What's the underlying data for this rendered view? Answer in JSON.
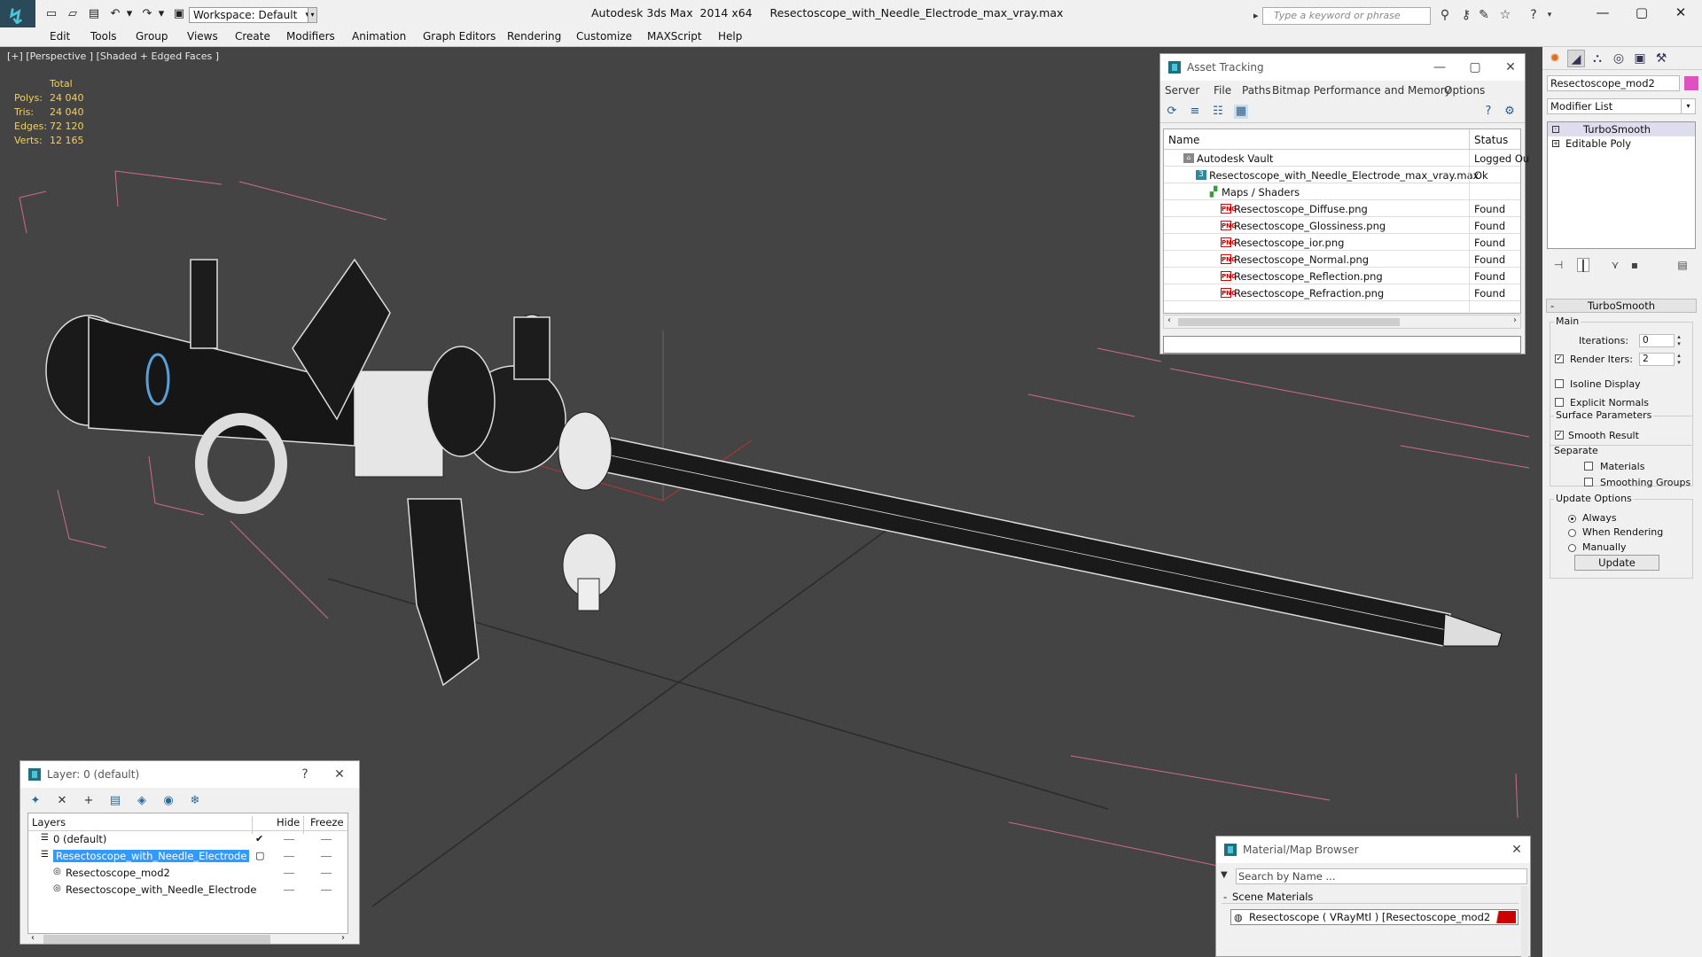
{
  "title": {
    "app": "Autodesk 3ds Max  2014 x64",
    "file": "Resectoscope_with_Needle_Electrode_max_vray.max",
    "workspace": "Workspace: Default",
    "search_placeholder": "Type a keyword or phrase"
  },
  "menu": [
    "Edit",
    "Tools",
    "Group",
    "Views",
    "Create",
    "Modifiers",
    "Animation",
    "Graph Editors",
    "Rendering",
    "Customize",
    "MAXScript",
    "Help"
  ],
  "viewport": {
    "label": "[+] [Perspective ] [Shaded + Edged Faces ]",
    "stats": {
      "header": "Total",
      "rows": [
        {
          "key": "Polys:",
          "value": "24 040"
        },
        {
          "key": "Tris:",
          "value": "24 040"
        },
        {
          "key": "Edges:",
          "value": "72 120"
        },
        {
          "key": "Verts:",
          "value": "12 165"
        }
      ]
    }
  },
  "asset_tracking": {
    "title": "Asset Tracking",
    "menu": [
      "Server",
      "File",
      "Paths",
      "Bitmap Performance and Memory",
      "Options"
    ],
    "columns": {
      "name": "Name",
      "status": "Status"
    },
    "rows": [
      {
        "name": "Autodesk Vault",
        "status": "Logged Ou",
        "indent": 0,
        "icon": "vault"
      },
      {
        "name": "Resectoscope_with_Needle_Electrode_max_vray.max",
        "status": "Ok",
        "indent": 1,
        "icon": "max"
      },
      {
        "name": "Maps / Shaders",
        "status": "",
        "indent": 2,
        "icon": "maps"
      },
      {
        "name": "Resectoscope_Diffuse.png",
        "status": "Found",
        "indent": 3,
        "icon": "png"
      },
      {
        "name": "Resectoscope_Glossiness.png",
        "status": "Found",
        "indent": 3,
        "icon": "png"
      },
      {
        "name": "Resectoscope_ior.png",
        "status": "Found",
        "indent": 3,
        "icon": "png"
      },
      {
        "name": "Resectoscope_Normal.png",
        "status": "Found",
        "indent": 3,
        "icon": "png"
      },
      {
        "name": "Resectoscope_Reflection.png",
        "status": "Found",
        "indent": 3,
        "icon": "png"
      },
      {
        "name": "Resectoscope_Refraction.png",
        "status": "Found",
        "indent": 3,
        "icon": "png"
      }
    ]
  },
  "layers": {
    "title": "Layer: 0 (default)",
    "help": "?",
    "columns": {
      "layers": "Layers",
      "hide": "Hide",
      "freeze": "Freeze"
    },
    "rows": [
      {
        "name": "0 (default)",
        "indent": 0,
        "selected": false,
        "check": "✔"
      },
      {
        "name": "Resectoscope_with_Needle_Electrode",
        "indent": 0,
        "selected": true,
        "check": "▢"
      },
      {
        "name": "Resectoscope_mod2",
        "indent": 1,
        "selected": false,
        "check": ""
      },
      {
        "name": "Resectoscope_with_Needle_Electrode",
        "indent": 1,
        "selected": false,
        "check": ""
      }
    ]
  },
  "material_browser": {
    "title": "Material/Map Browser",
    "search_placeholder": "Search by Name ...",
    "section": "Scene Materials",
    "item": "Resectoscope  ( VRayMtl )  [Resectoscope_mod2]"
  },
  "command_panel": {
    "object_name": "Resectoscope_mod2",
    "object_color": "#e050c0",
    "modifier_list": "Modifier List",
    "stack": [
      {
        "name": "TurboSmooth",
        "selected": true
      },
      {
        "name": "Editable Poly",
        "selected": false
      }
    ],
    "rollout": "TurboSmooth",
    "main_group": "Main",
    "iterations_label": "Iterations:",
    "iterations_value": "0",
    "render_iters_label": "Render Iters:",
    "render_iters_value": "2",
    "isoline": "Isoline Display",
    "explicit_normals": "Explicit Normals",
    "surface_group": "Surface Parameters",
    "smooth_result": "Smooth Result",
    "separate": "Separate",
    "materials": "Materials",
    "smoothing_groups": "Smoothing Groups",
    "update_group": "Update Options",
    "always": "Always",
    "when_rendering": "When Rendering",
    "manually": "Manually",
    "update_button": "Update"
  }
}
